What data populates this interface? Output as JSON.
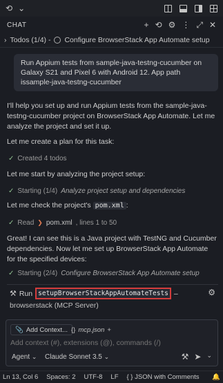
{
  "titlebar": {
    "sync_glyph": "⟲",
    "chevron_glyph": "⌄",
    "icons": [
      "split-editor-icon",
      "panel-bottom-icon",
      "sidebar-right-icon",
      "layout-grid-icon"
    ]
  },
  "chat": {
    "label": "CHAT",
    "icons": [
      "+",
      "⟲",
      "⚙",
      "⋮",
      "⤢",
      "✕"
    ]
  },
  "todos": {
    "chevron": "›",
    "label": "Todos (1/4) -",
    "current": "Configure BrowserStack App Automate setup"
  },
  "user_message": "Run Appium tests from sample-java-testng-cucumber on Galaxy S21 and Pixel 6 with Android 12. App path issample-java-testng-cucumber",
  "responses": {
    "intro": "I'll help you set up and run Appium tests from the sample-java-testng-cucumber project on BrowserStack App Automate. Let me analyze the project and set it up.",
    "plan": "Let me create a plan for this task:",
    "created": "Created 4 todos",
    "analyze": "Let me start by analyzing the project setup:",
    "starting1_prefix": "Starting (1/4)",
    "starting1_task": "Analyze project setup and dependencies",
    "check_prefix": "Let me check the project's",
    "check_file": "pom.xml",
    "check_suffix": ":",
    "read_label": "Read",
    "read_file": "pom.xml",
    "read_lines": ", lines 1 to 50",
    "great": "Great! I can see this is a Java project with TestNG and Cucumber dependencies. Now let me set up BrowserStack App Automate for the specified devices:",
    "starting2_prefix": "Starting (2/4)",
    "starting2_task": "Configure BrowserStack App Automate setup"
  },
  "tool": {
    "run_label": "Run",
    "function": "setupBrowserStackAppAutomateTests",
    "dash": "–",
    "server": "browserstack (MCP Server)"
  },
  "input": {
    "add_context": "Add Context...",
    "file_chip": "mcp.json",
    "file_chip_suffix": "+",
    "placeholder": "Add context (#), extensions (@), commands (/)",
    "agent": "Agent",
    "model": "Claude Sonnet 3.5"
  },
  "statusbar": {
    "position": "Ln 13, Col 6",
    "spaces": "Spaces: 2",
    "encoding": "UTF-8",
    "eol": "LF",
    "language": "{ }  JSON with Comments"
  },
  "colors": {
    "background": "#1b1d23",
    "highlight_border": "#d43c3c",
    "check": "#8fbf8f"
  }
}
